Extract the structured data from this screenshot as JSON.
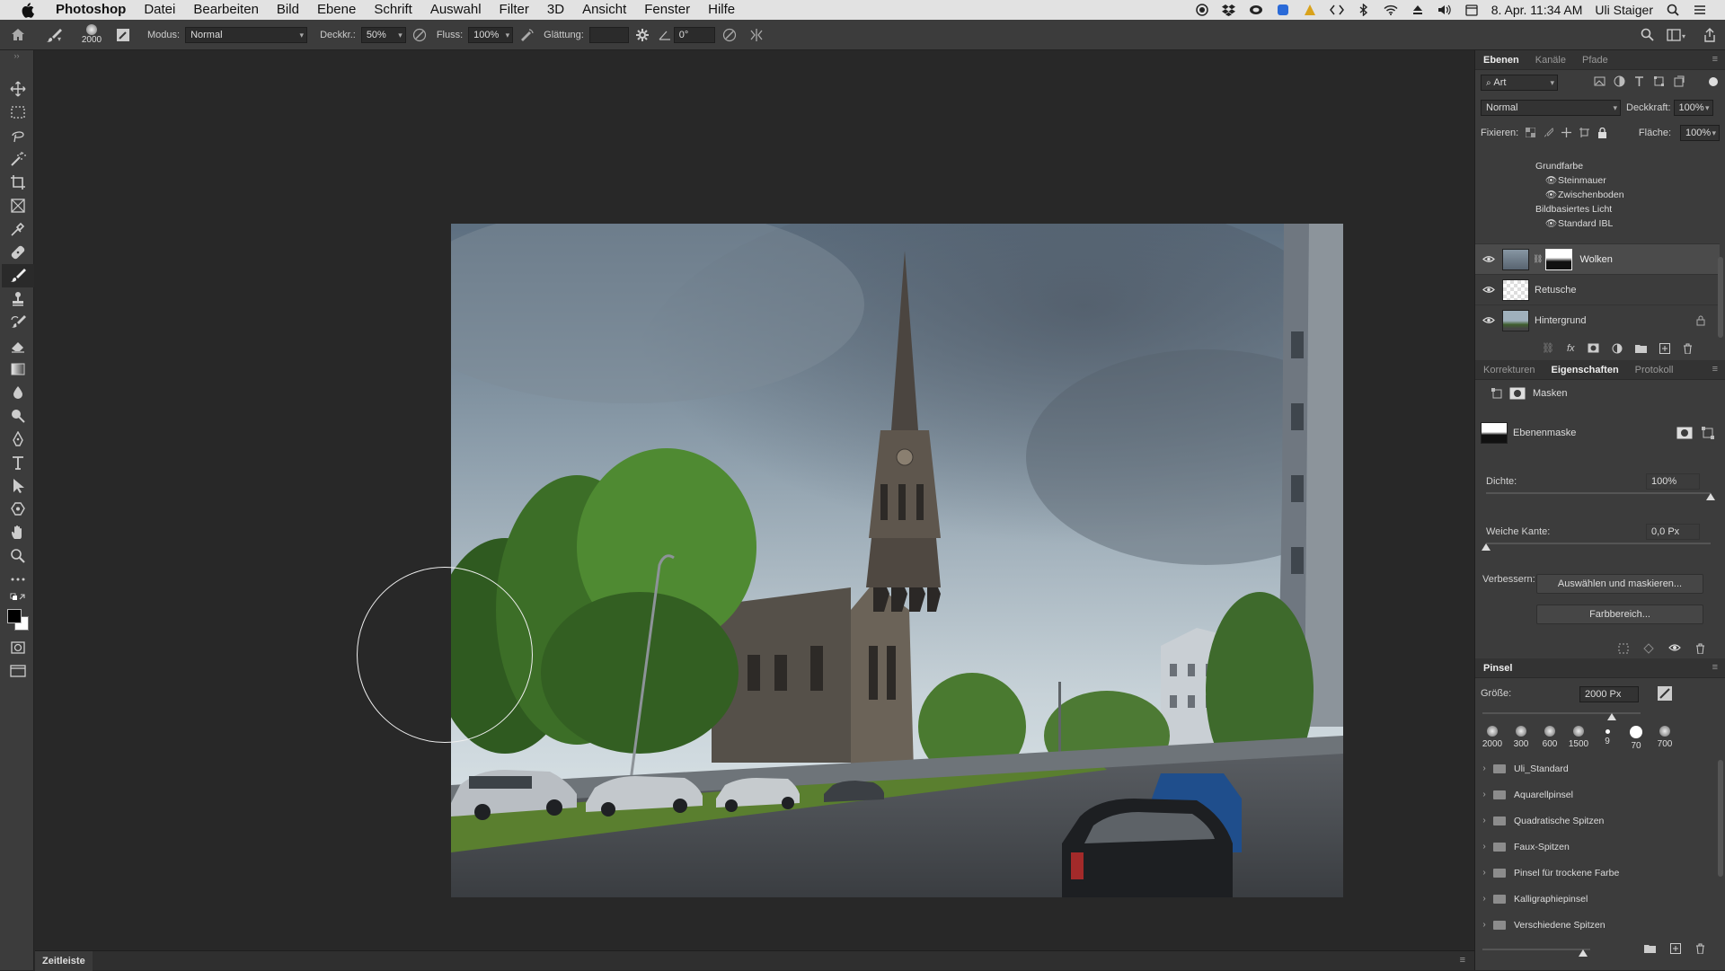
{
  "menubar": {
    "app": "Photoshop",
    "items": [
      "Datei",
      "Bearbeiten",
      "Bild",
      "Ebene",
      "Schrift",
      "Auswahl",
      "Filter",
      "3D",
      "Ansicht",
      "Fenster",
      "Hilfe"
    ],
    "datetime": "8. Apr. 11:34 AM",
    "user": "Uli Staiger"
  },
  "options": {
    "brush_size": "2000",
    "mode_label": "Modus:",
    "mode_value": "Normal",
    "opacity_label": "Deckkr.:",
    "opacity_value": "50%",
    "flow_label": "Fluss:",
    "flow_value": "100%",
    "smoothing_label": "Glättung:",
    "smoothing_value": "",
    "angle_value": "0°"
  },
  "layers_panel": {
    "tabs": [
      "Ebenen",
      "Kanäle",
      "Pfade"
    ],
    "active_tab": "Ebenen",
    "filter_kind": "Art",
    "blend_mode": "Normal",
    "opacity_label": "Deckkraft:",
    "opacity_value": "100%",
    "lock_label": "Fixieren:",
    "fill_label": "Fläche:",
    "fill_value": "100%",
    "fx_items": [
      {
        "label": "Grundfarbe",
        "indent": 1,
        "eye": false
      },
      {
        "label": "Steinmauer",
        "indent": 2,
        "eye": true
      },
      {
        "label": "Zwischenboden",
        "indent": 2,
        "eye": true
      },
      {
        "label": "Bildbasiertes Licht",
        "indent": 1,
        "eye": false
      },
      {
        "label": "Standard IBL",
        "indent": 2,
        "eye": true
      }
    ],
    "layers": [
      {
        "name": "Wolken",
        "selected": true,
        "has_mask": true,
        "locked": false
      },
      {
        "name": "Retusche",
        "selected": false,
        "has_mask": false,
        "locked": false
      },
      {
        "name": "Hintergrund",
        "selected": false,
        "has_mask": false,
        "locked": true
      }
    ]
  },
  "properties_panel": {
    "tabs": [
      "Korrekturen",
      "Eigenschaften",
      "Protokoll"
    ],
    "active_tab": "Eigenschaften",
    "section": "Masken",
    "mask_name": "Ebenenmaske",
    "density_label": "Dichte:",
    "density_value": "100%",
    "density_level": 1.0,
    "feather_label": "Weiche Kante:",
    "feather_value": "0,0 Px",
    "feather_level": 0.0,
    "refine_label": "Verbessern:",
    "btn_select_mask": "Auswählen und maskieren...",
    "btn_color_range": "Farbbereich..."
  },
  "brush_panel": {
    "title": "Pinsel",
    "size_label": "Größe:",
    "size_value": "2000 Px",
    "size_level": 0.82,
    "presets": [
      "2000",
      "300",
      "600",
      "1500",
      "9",
      "70",
      "700"
    ],
    "folders": [
      "Uli_Standard",
      "Aquarellpinsel",
      "Quadratische Spitzen",
      "Faux-Spitzen",
      "Pinsel für trockene Farbe",
      "Kalligraphiepinsel",
      "Verschiedene Spitzen"
    ]
  },
  "status": {
    "timeline_tab": "Zeitleiste"
  }
}
